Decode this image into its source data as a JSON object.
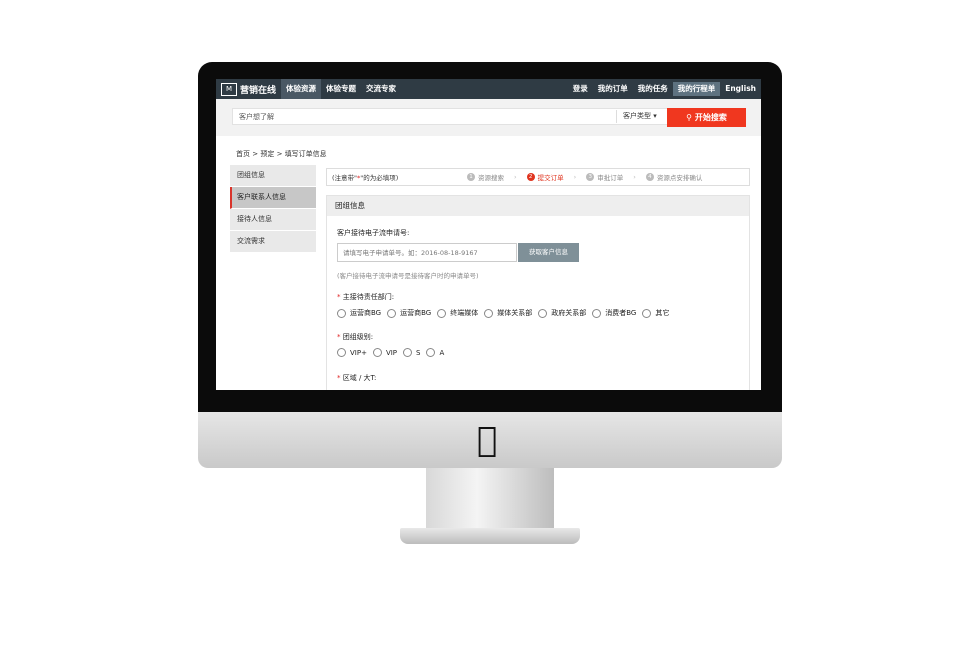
{
  "nav": {
    "brand": "营销在线",
    "brand_mark": "Online",
    "left_items": [
      "体验资源",
      "体验专题",
      "交流专家"
    ],
    "right_items": [
      "登录",
      "我的订单",
      "我的任务",
      "我的行程单",
      "English"
    ]
  },
  "search": {
    "placeholder": "客户想了解",
    "customer_type": "客户类型",
    "button": "开始搜索"
  },
  "breadcrumb": [
    "首页",
    ">",
    "预定",
    ">",
    "填写订单信息"
  ],
  "sidebar": {
    "items": [
      "团组信息",
      "客户联系人信息",
      "接待人信息",
      "交流需求"
    ],
    "active_index": 1
  },
  "steps": {
    "note_prefix": "(注意带\"",
    "note_star": "*",
    "note_suffix": "\"的为必填项)",
    "items": [
      {
        "num": "1",
        "label": "资源搜索"
      },
      {
        "num": "2",
        "label": "提交订单"
      },
      {
        "num": "3",
        "label": "审批订单"
      },
      {
        "num": "4",
        "label": "资源点安排确认"
      }
    ],
    "current": 1
  },
  "panel": {
    "title": "团组信息",
    "ref_label": "客户接待电子流申请号:",
    "ref_placeholder": "请填写电子申请单号。如：2016-08-18-9167",
    "ref_button": "获取客户信息",
    "ref_hint": "(客户接待电子流申请号是接待客户时的申请单号)",
    "dept_label": "主接待责任部门:",
    "dept_options": [
      "运营商BG",
      "运营商BG",
      "终端媒体",
      "媒体关系部",
      "政府关系部",
      "消费者BG",
      "其它"
    ],
    "level_label": "团组级别:",
    "level_options": [
      "VIP+",
      "VIP",
      "S",
      "A"
    ],
    "region_label": "区域 / 大T:"
  },
  "colors": {
    "nav_bg": "#2f3b44",
    "accent": "#f0371f",
    "sidebar_active": "#d9342b"
  },
  "icons": {
    "search": "search-icon",
    "apple": "apple-logo-icon"
  }
}
